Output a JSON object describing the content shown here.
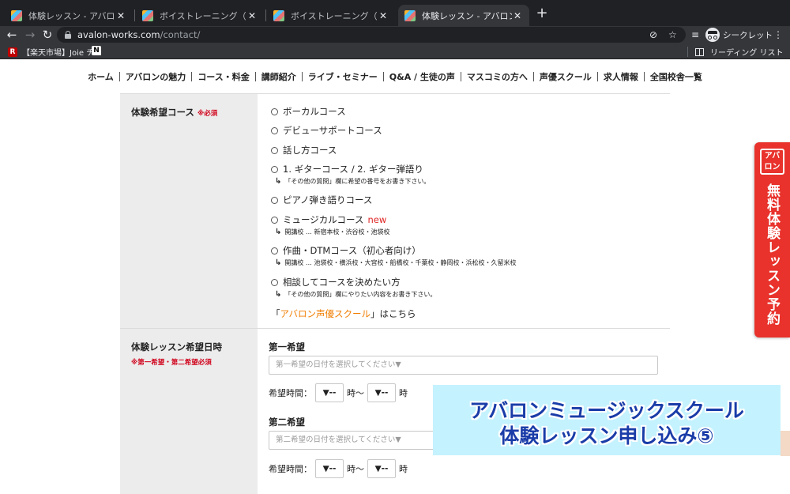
{
  "browser": {
    "tabs": [
      {
        "title": "体験レッスン - アバロン・ミュージ",
        "active": false
      },
      {
        "title": "ボイストレーニング（ボイトレ）の",
        "active": false
      },
      {
        "title": "ボイストレーニング（ボイトレ）の",
        "active": false
      },
      {
        "title": "体験レッスン - アバロン・ミュージ",
        "active": true
      }
    ],
    "new_tab": "+",
    "url_host": "avalon-works.com",
    "url_path": "/contact/",
    "incognito_label": "シークレット",
    "bookmarks": [
      {
        "label": "【楽天市場】Joie チ…",
        "icon": "R"
      },
      {
        "label": "",
        "icon": "N"
      }
    ],
    "reading_list": "リーディング リスト",
    "colors": {
      "tabbar": "#202124",
      "toolbar": "#35363a"
    }
  },
  "site_nav": {
    "items": [
      "ホーム",
      "アバロンの魅力",
      "コース・料金",
      "講師紹介",
      "ライブ・セミナー",
      "Q&A / 生徒の声",
      "マスコミの方へ",
      "声優スクール",
      "求人情報",
      "全国校舎一覧"
    ]
  },
  "form": {
    "course": {
      "label": "体験希望コース",
      "required": "※必須",
      "options": [
        {
          "label": "ボーカルコース"
        },
        {
          "label": "デビューサポートコース"
        },
        {
          "label": "話し方コース"
        },
        {
          "label": "1. ギターコース / 2. ギター弾語り",
          "note": "「その他の質問」欄に希望の番号をお書き下さい。"
        },
        {
          "label": "ピアノ弾き語りコース"
        },
        {
          "label": "ミュージカルコース",
          "badge": "new",
          "note": "開講校 … 新宿本校・渋谷校・池袋校"
        },
        {
          "label": "作曲・DTMコース（初心者向け）",
          "note": "開講校 … 池袋校・横浜校・大宮校・船橋校・千葉校・静岡校・浜松校・久留米校"
        },
        {
          "label": "相談してコースを決めたい方",
          "note": "「その他の質問」欄にやりたい内容をお書き下さい。"
        }
      ],
      "seiyu_open": "「",
      "seiyu_link": "アバロン声優スクール",
      "seiyu_close": "」はこちら"
    },
    "date": {
      "label": "体験レッスン希望日時",
      "required_note": "※第一希望・第二希望必須",
      "first": {
        "title": "第一希望",
        "placeholder": "第一希望の日付を選択してください▼",
        "time_label": "希望時間：",
        "hour_sel": "▼--",
        "hour_unit": "時〜",
        "end_sel": "▼--",
        "end_unit": "時"
      },
      "second": {
        "title": "第二希望",
        "placeholder": "第二希望の日付を選択してください▼",
        "time_label": "希望時間：",
        "hour_sel": "▼--",
        "hour_unit": "時〜",
        "end_sel": "▼--",
        "end_unit": "時"
      }
    }
  },
  "side_banner": {
    "logo": "アバロン",
    "text": "無料体験レッスン予約",
    "color": "#e8322b"
  },
  "overlay": {
    "line1": "アバロンミュージックスクール",
    "line2": "体験レッスン申し込み⑤"
  }
}
